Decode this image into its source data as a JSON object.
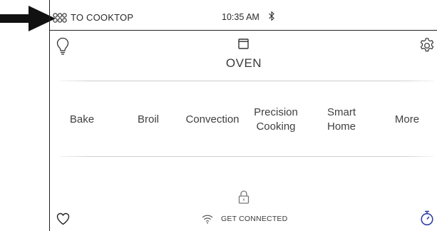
{
  "status_bar": {
    "cooktop_label": "TO COOKTOP",
    "time": "10:35 AM"
  },
  "header": {
    "title": "OVEN"
  },
  "modes": [
    {
      "label": "Bake"
    },
    {
      "label": "Broil"
    },
    {
      "label": "Convection"
    },
    {
      "label": "Precision Cooking"
    },
    {
      "label": "Smart Home"
    },
    {
      "label": "More"
    }
  ],
  "footer": {
    "connect_label": "GET CONNECTED"
  },
  "icons": {
    "cooktop": "cooktop-icon",
    "bluetooth": "bluetooth-icon",
    "light": "lightbulb-icon",
    "settings": "gear-icon",
    "oven": "oven-icon",
    "lock": "lock-icon",
    "favorites": "heart-icon",
    "wifi": "wifi-icon",
    "timer": "timer-icon"
  },
  "colors": {
    "text": "#3a3a3a",
    "timer_accent": "#2f3fa8",
    "divider": "#cfcfcf"
  }
}
